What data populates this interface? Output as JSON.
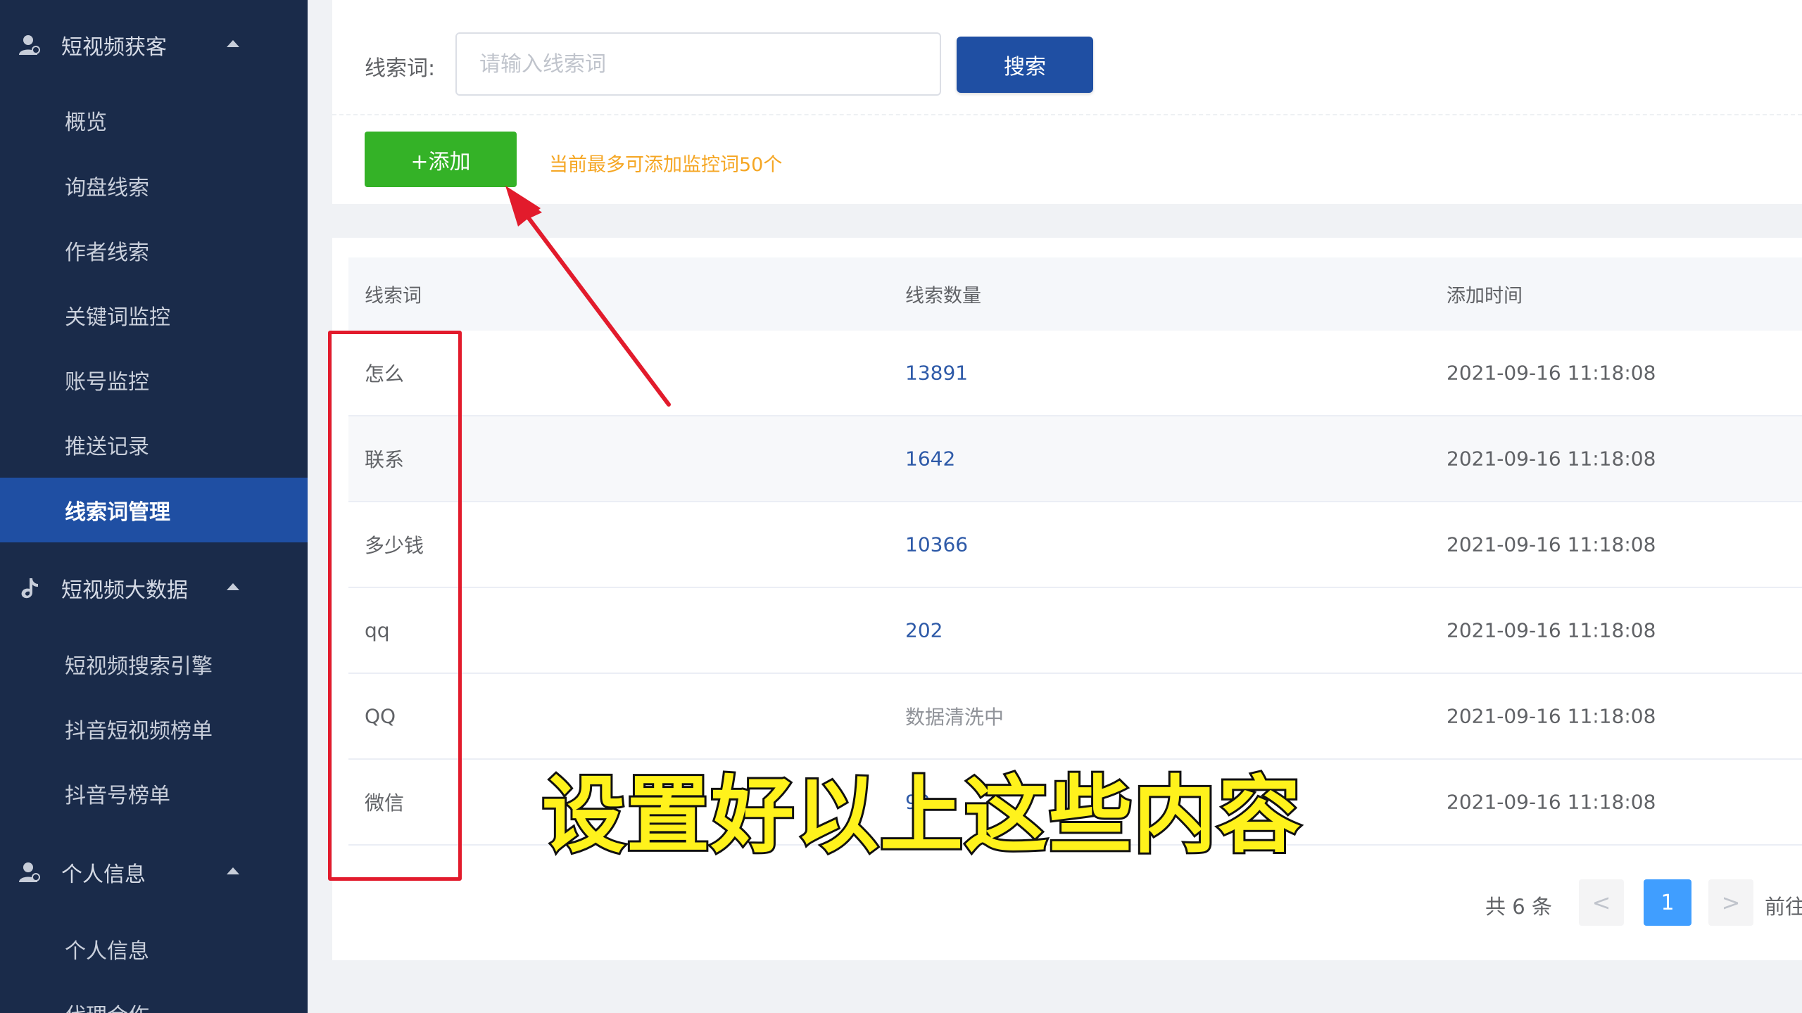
{
  "sidebar": {
    "groups": [
      {
        "label": "短视频获客",
        "icon": "user-icon",
        "items": [
          "概览",
          "询盘线索",
          "作者线索",
          "关键词监控",
          "账号监控",
          "推送记录",
          "线索词管理"
        ],
        "active_item": "线索词管理"
      },
      {
        "label": "短视频大数据",
        "icon": "music-note-icon",
        "items": [
          "短视频搜索引擎",
          "抖音短视频榜单",
          "抖音号榜单"
        ]
      },
      {
        "label": "个人信息",
        "icon": "user-icon",
        "items": [
          "个人信息",
          "代理合作"
        ]
      }
    ]
  },
  "search": {
    "label": "线索词:",
    "placeholder": "请输入线索词",
    "button": "搜索"
  },
  "toolbar": {
    "add_button": "+添加",
    "tip": "当前最多可添加监控词50个"
  },
  "table": {
    "headers": [
      "线索词",
      "线索数量",
      "添加时间"
    ],
    "rows": [
      {
        "word": "怎么",
        "count": "13891",
        "time": "2021-09-16 11:18:08"
      },
      {
        "word": "联系",
        "count": "1642",
        "time": "2021-09-16 11:18:08"
      },
      {
        "word": "多少钱",
        "count": "10366",
        "time": "2021-09-16 11:18:08"
      },
      {
        "word": "qq",
        "count": "202",
        "time": "2021-09-16 11:18:08"
      },
      {
        "word": "QQ",
        "count": "数据清洗中",
        "time": "2021-09-16 11:18:08"
      },
      {
        "word": "微信",
        "count": "99",
        "time": "2021-09-16 11:18:08"
      }
    ]
  },
  "pagination": {
    "total": "共 6 条",
    "current_page": "1",
    "prev": "<",
    "next": ">",
    "goto": "前往"
  },
  "annotation": {
    "caption": "设置好以上这些内容",
    "color_caption": "#fff21c",
    "color_highlight": "#e21b2c"
  },
  "colors": {
    "sidebar_bg": "#1a2b4a",
    "active_bg": "#1f4fa3",
    "add_green": "#34b227",
    "tip_orange": "#f5a623",
    "page_blue": "#409eff"
  }
}
